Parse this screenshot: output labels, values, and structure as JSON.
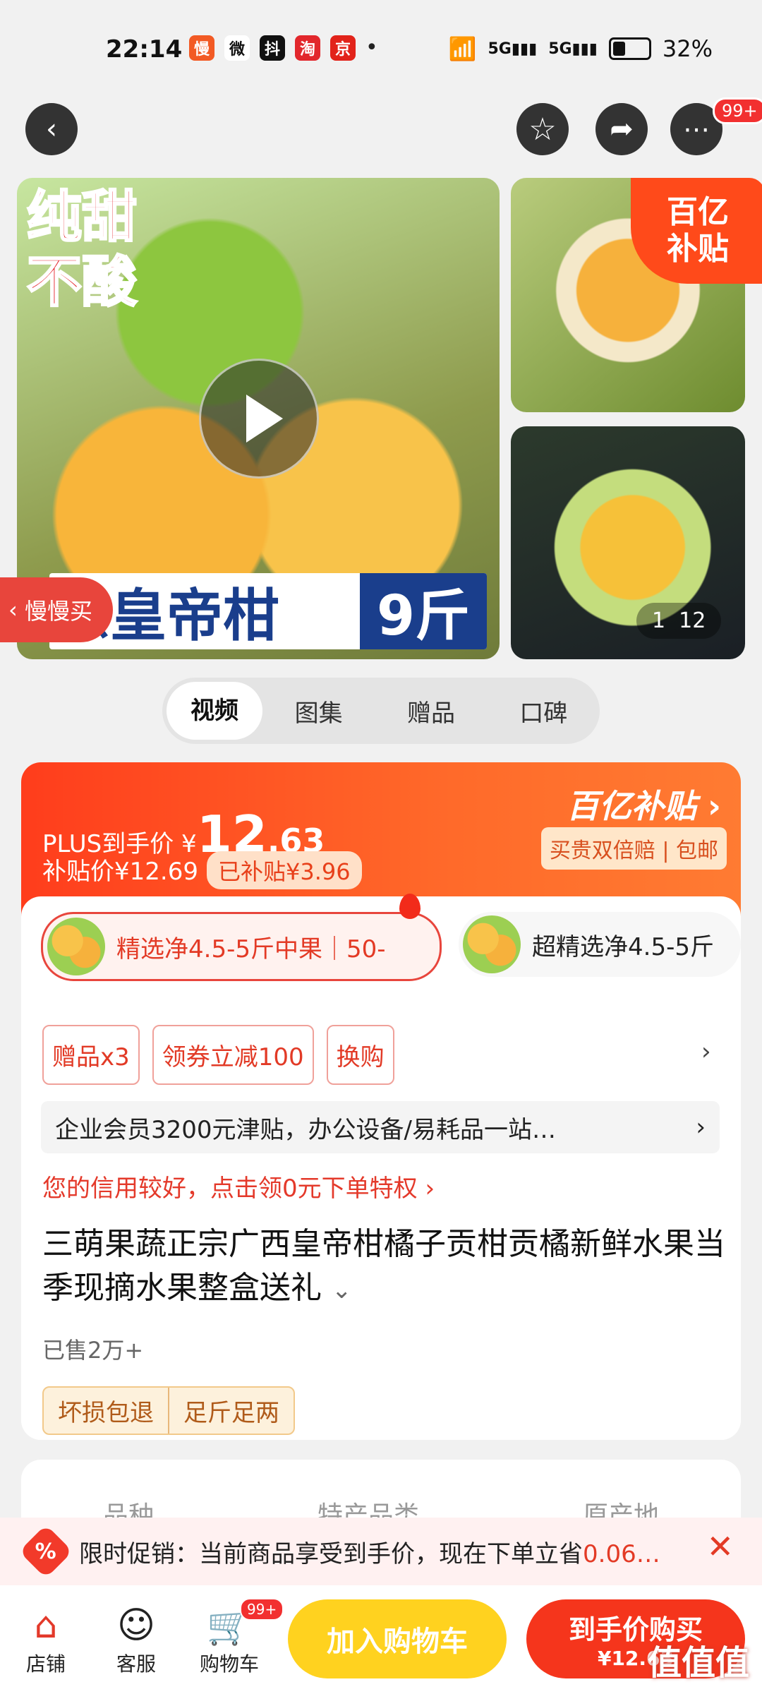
{
  "status": {
    "time": "22:14",
    "icons": [
      "慢",
      "微",
      "抖",
      "淘",
      "京"
    ],
    "battery": "32%"
  },
  "header": {
    "more_badge": "99+"
  },
  "gallery": {
    "overlay_text_line1": "纯甜",
    "overlay_text_line2": "不酸",
    "banner_text": "宗皇帝柑",
    "banner_weight": "9斤",
    "back_tag": "慢慢买",
    "yi_tag_line1": "百亿",
    "yi_tag_line2": "补贴",
    "counter_current": "1",
    "counter_total": "12"
  },
  "media_tabs": [
    "视频",
    "图集",
    "赠品",
    "口碑"
  ],
  "price": {
    "plus_label": "PLUS到手价",
    "currency": "¥",
    "plus_int": "12",
    "plus_dec": ".63",
    "subsidy_label": "补贴价¥12.69",
    "subsidy_badge": "已补贴¥3.96",
    "yi_label": "百亿补贴",
    "guarantee": "买贵双倍赔 | 包邮"
  },
  "options": [
    {
      "label": "精选净4.5-5斤中果｜50-"
    },
    {
      "label": "超精选净4.5-5斤"
    }
  ],
  "chips": [
    "赠品x3",
    "领券立减100",
    "换购"
  ],
  "member_text": "企业会员3200元津贴，办公设备/易耗品一站…",
  "credit_text": "您的信用较好，点击领0元下单特权 ›",
  "product_title": "三萌果蔬正宗广西皇帝柑橘子贡柑贡橘新鲜水果当季现摘水果整盒送礼",
  "sold": "已售2万+",
  "service_tags": [
    "坏损包退",
    "足斤足两"
  ],
  "attrs": [
    "品种",
    "特产品类",
    "原产地"
  ],
  "promo": {
    "prefix": "限时促销：当前商品享受到手价，现在下单立省",
    "amount": "0.06…"
  },
  "bottom": {
    "store": "店铺",
    "service": "客服",
    "cart": "购物车",
    "cart_badge": "99+",
    "add_cart": "加入购物车",
    "buy_line1": "到手价购买",
    "buy_line2": "¥12.63"
  },
  "watermark": "值值值",
  "colors": {
    "accent": "#f5351c",
    "yellow": "#ffd21f",
    "promo_bg": "#fff1f1"
  }
}
